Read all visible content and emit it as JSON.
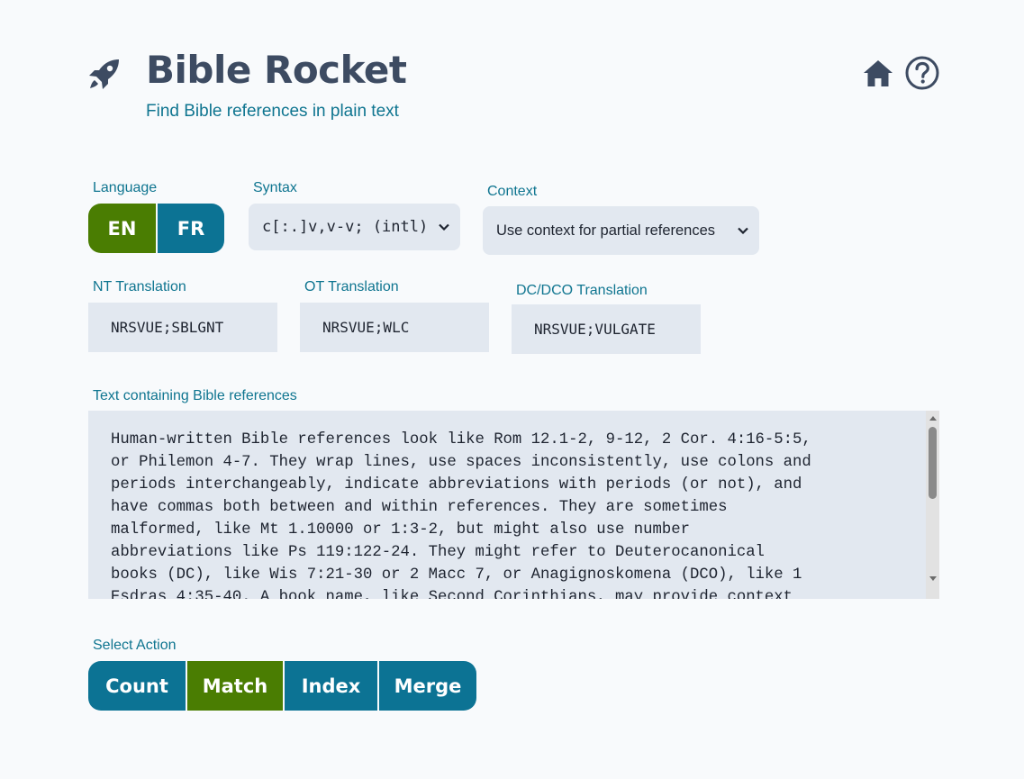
{
  "header": {
    "title": "Bible Rocket",
    "subtitle": "Find Bible references in plain text",
    "icons": [
      "rocket-icon",
      "home-icon",
      "help-icon"
    ]
  },
  "language": {
    "label": "Language",
    "options": [
      "EN",
      "FR"
    ],
    "selected": "EN"
  },
  "syntax": {
    "label": "Syntax",
    "value": "c[:.]v,v-v; (intl)"
  },
  "context": {
    "label": "Context",
    "value": "Use context for partial references"
  },
  "nt": {
    "label": "NT Translation",
    "value": "NRSVUE;SBLGNT"
  },
  "ot": {
    "label": "OT Translation",
    "value": "NRSVUE;WLC"
  },
  "dc": {
    "label": "DC/DCO Translation",
    "value": "NRSVUE;VULGATE"
  },
  "text": {
    "label": "Text containing Bible references",
    "lines": [
      "Human-written Bible references look like Rom 12.1-2, 9-12, 2 Cor. 4:16-5:5,",
      "or Philemon 4-7. They wrap lines, use spaces inconsistently, use colons and",
      "periods interchangeably, indicate abbreviations with periods (or not), and",
      "have commas both between and within references. They are sometimes",
      "malformed, like Mt 1.10000 or 1:3-2, but might also use number",
      "abbreviations like Ps 119:122-24. They might refer to Deuterocanonical",
      "books (DC), like Wis 7:21-30 or 2 Macc 7, or Anagignoskomena (DCO), like 1",
      "Esdras 4:35-40. A book name, like Second Corinthians, may provide context"
    ]
  },
  "actions": {
    "label": "Select Action",
    "buttons": [
      "Count",
      "Match",
      "Index",
      "Merge"
    ],
    "selected": "Match"
  },
  "colors": {
    "primary": "#0c7394",
    "active": "#4a7d02",
    "field_bg": "#e2e8f0",
    "heading": "#3d4b62",
    "label": "#0f7590"
  }
}
